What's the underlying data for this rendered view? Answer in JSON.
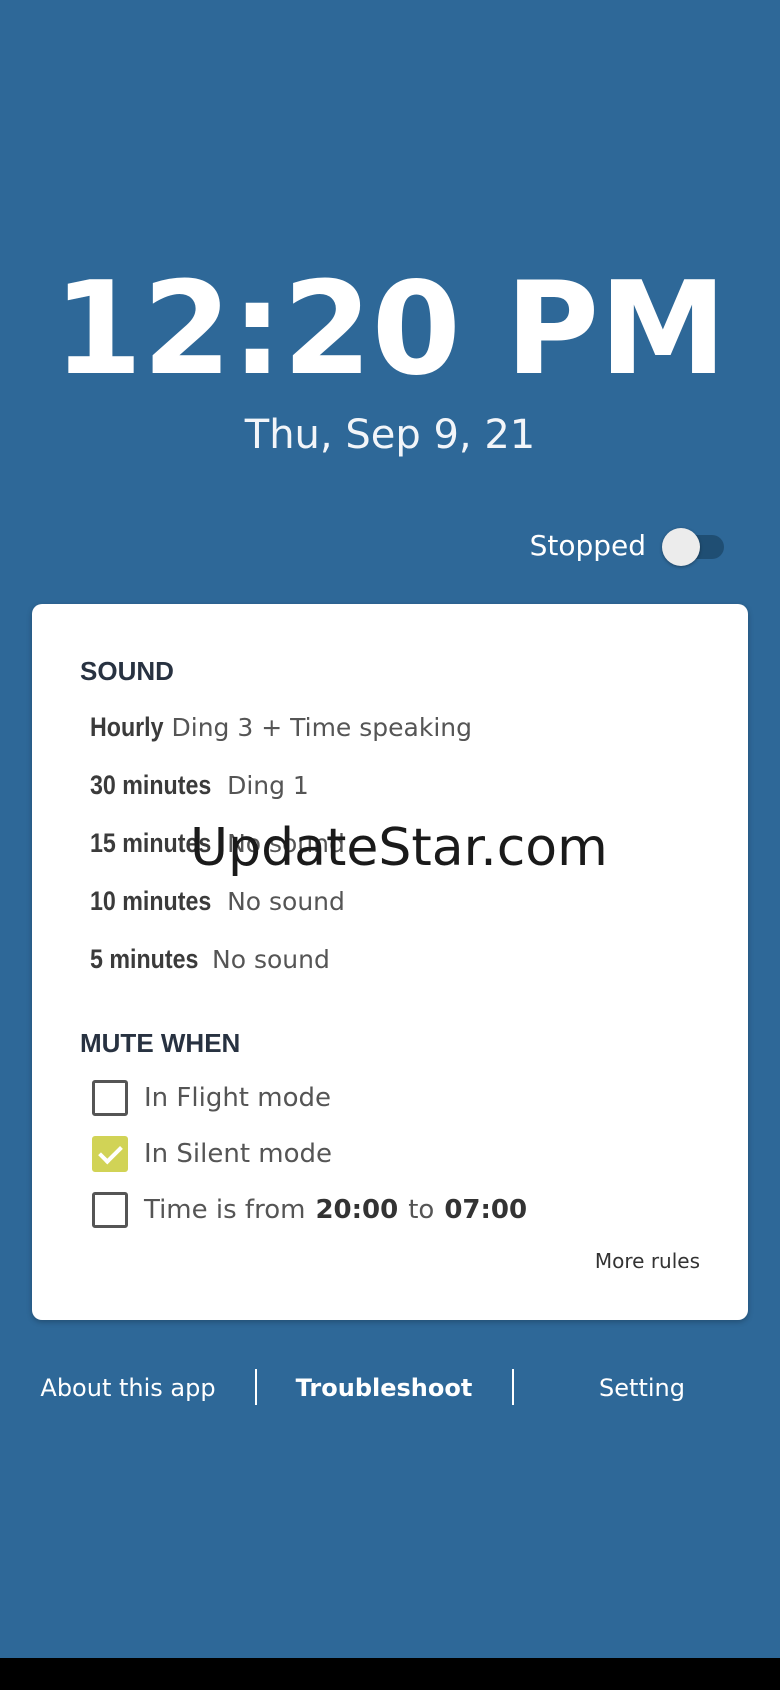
{
  "clock": {
    "time": "12:20 PM",
    "date": "Thu, Sep 9, 21"
  },
  "status": {
    "label": "Stopped",
    "toggle_on": false
  },
  "sound": {
    "title": "SOUND",
    "rows": [
      {
        "key": "Hourly",
        "value": "Ding 3 + Time speaking"
      },
      {
        "key": "30 minutes",
        "value": "Ding 1"
      },
      {
        "key": "15 minutes",
        "value": "No sound"
      },
      {
        "key": "10 minutes",
        "value": "No sound"
      },
      {
        "key": "5 minutes",
        "value": "No sound"
      }
    ]
  },
  "mute": {
    "title": "MUTE WHEN",
    "flight_label": "In Flight mode",
    "flight_checked": false,
    "silent_label": "In Silent mode",
    "silent_checked": true,
    "time_prefix": "Time is from",
    "time_from": "20:00",
    "time_mid": "to",
    "time_to": "07:00",
    "time_checked": false,
    "more_rules": "More rules"
  },
  "footer": {
    "about": "About this app",
    "troubleshoot": "Troubleshoot",
    "setting": "Setting"
  },
  "watermark": "UpdateStar.com",
  "colors": {
    "background": "#2e6898",
    "checkbox_accent": "#d1d356",
    "toggle_track": "#1f4e73"
  }
}
